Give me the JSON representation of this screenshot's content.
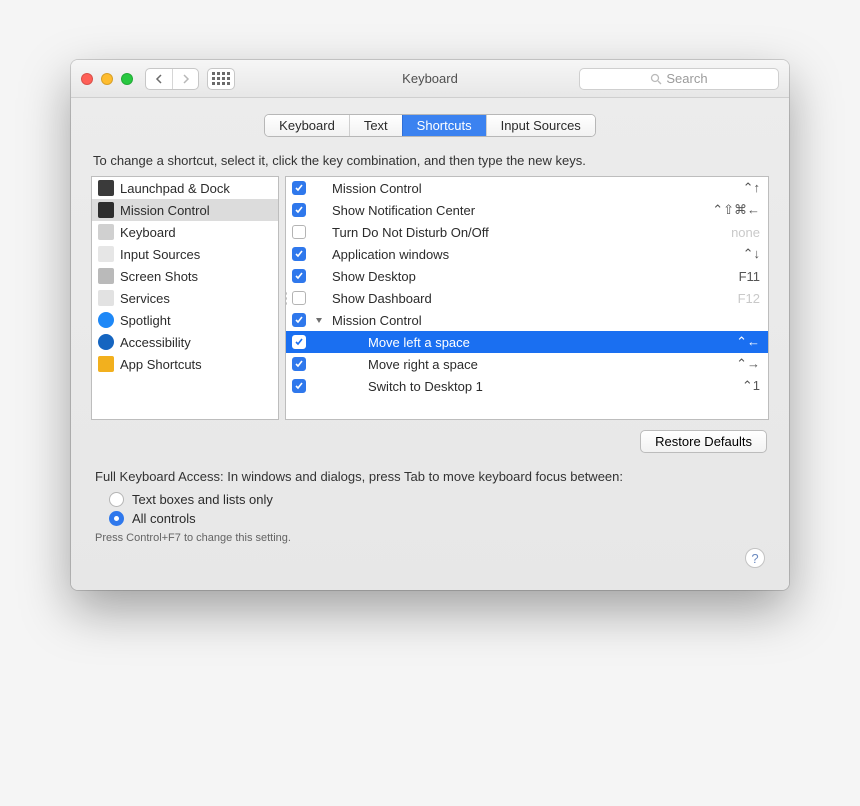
{
  "window": {
    "title": "Keyboard"
  },
  "search": {
    "placeholder": "Search"
  },
  "tabs": [
    "Keyboard",
    "Text",
    "Shortcuts",
    "Input Sources"
  ],
  "tabs_active_index": 2,
  "instructions": "To change a shortcut, select it, click the key combination, and then type the new keys.",
  "categories": [
    {
      "label": "Launchpad & Dock",
      "icon": "launchpad"
    },
    {
      "label": "Mission Control",
      "icon": "mission",
      "selected": true
    },
    {
      "label": "Keyboard",
      "icon": "keyboard"
    },
    {
      "label": "Input Sources",
      "icon": "input"
    },
    {
      "label": "Screen Shots",
      "icon": "screenshots"
    },
    {
      "label": "Services",
      "icon": "services"
    },
    {
      "label": "Spotlight",
      "icon": "spotlight"
    },
    {
      "label": "Accessibility",
      "icon": "accessibility"
    },
    {
      "label": "App Shortcuts",
      "icon": "appshortcuts"
    }
  ],
  "shortcuts": [
    {
      "checked": true,
      "indent": 0,
      "label": "Mission Control",
      "key": "⌃↑"
    },
    {
      "checked": true,
      "indent": 0,
      "label": "Show Notification Center",
      "key": "⌃⇧⌘←"
    },
    {
      "checked": false,
      "indent": 0,
      "label": "Turn Do Not Disturb On/Off",
      "key": "none",
      "disabled_key": true
    },
    {
      "checked": true,
      "indent": 0,
      "label": "Application windows",
      "key": "⌃↓"
    },
    {
      "checked": true,
      "indent": 0,
      "label": "Show Desktop",
      "key": "F11"
    },
    {
      "checked": false,
      "indent": 0,
      "label": "Show Dashboard",
      "key": "F12",
      "disabled_key": true
    },
    {
      "checked": true,
      "indent": 0,
      "label": "Mission Control",
      "key": "",
      "disclosure": true
    },
    {
      "checked": true,
      "indent": 2,
      "label": "Move left a space",
      "key": "⌃←",
      "selected": true
    },
    {
      "checked": true,
      "indent": 2,
      "label": "Move right a space",
      "key": "⌃→"
    },
    {
      "checked": true,
      "indent": 2,
      "label": "Switch to Desktop 1",
      "key": "⌃1"
    }
  ],
  "restore_label": "Restore Defaults",
  "fka_label": "Full Keyboard Access: In windows and dialogs, press Tab to move keyboard focus between:",
  "fka_options": [
    "Text boxes and lists only",
    "All controls"
  ],
  "fka_selected_index": 1,
  "fka_hint": "Press Control+F7 to change this setting."
}
